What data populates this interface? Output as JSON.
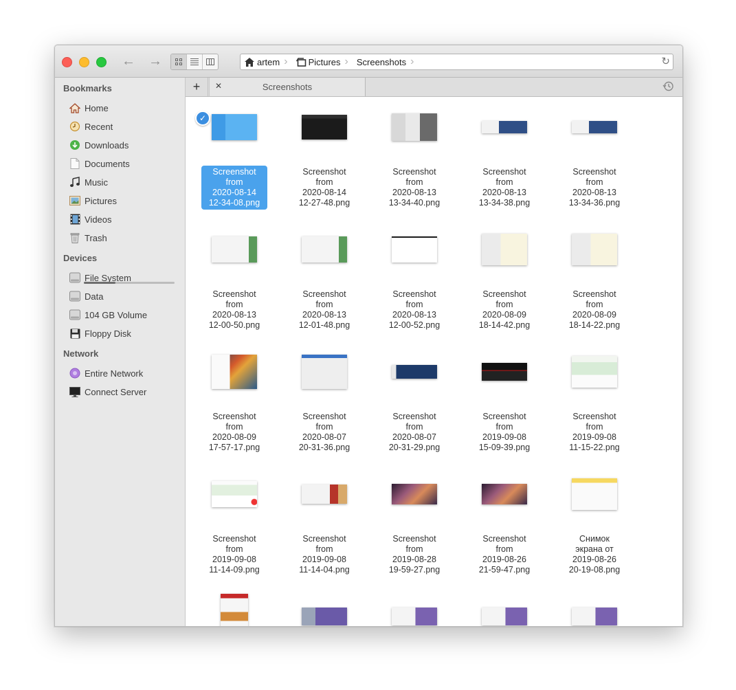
{
  "toolbar": {
    "back_icon": "←",
    "forward_icon": "→",
    "path": [
      {
        "label": "artem",
        "icon": "home-icon"
      },
      {
        "label": "Pictures",
        "icon": "pictures-icon"
      },
      {
        "label": "Screenshots",
        "icon": ""
      }
    ],
    "reload_icon": "↻"
  },
  "sidebar": {
    "bookmarks_heading": "Bookmarks",
    "bookmarks": [
      {
        "label": "Home",
        "icon": "home-icon"
      },
      {
        "label": "Recent",
        "icon": "clock-icon"
      },
      {
        "label": "Downloads",
        "icon": "download-icon"
      },
      {
        "label": "Documents",
        "icon": "document-icon"
      },
      {
        "label": "Music",
        "icon": "music-note-icon"
      },
      {
        "label": "Pictures",
        "icon": "pictures-icon"
      },
      {
        "label": "Videos",
        "icon": "film-icon"
      },
      {
        "label": "Trash",
        "icon": "trash-icon"
      }
    ],
    "devices_heading": "Devices",
    "devices": [
      {
        "label": "File System",
        "icon": "drive-icon"
      },
      {
        "label": "Data",
        "icon": "drive-icon"
      },
      {
        "label": "104 GB Volume",
        "icon": "drive-icon"
      },
      {
        "label": "Floppy Disk",
        "icon": "floppy-icon"
      }
    ],
    "file_system_usage": 0.35,
    "network_heading": "Network",
    "network": [
      {
        "label": "Entire Network",
        "icon": "network-icon"
      },
      {
        "label": "Connect Server",
        "icon": "monitor-icon"
      }
    ]
  },
  "tabs": {
    "new_tab": "+",
    "close": "✕",
    "active_label": "Screenshots"
  },
  "files": [
    {
      "name": "Screenshot\nfrom\n2020-08-14\n12-34-08.png",
      "selected": true,
      "style": "blue"
    },
    {
      "name": "Screenshot\nfrom\n2020-08-14\n12-27-48.png",
      "style": "dark"
    },
    {
      "name": "Screenshot\nfrom\n2020-08-13\n13-34-40.png",
      "style": "collage"
    },
    {
      "name": "Screenshot\nfrom\n2020-08-13\n13-34-38.png",
      "style": "desk"
    },
    {
      "name": "Screenshot\nfrom\n2020-08-13\n13-34-36.png",
      "style": "desk"
    },
    {
      "name": "Screenshot\nfrom\n2020-08-13\n12-00-50.png",
      "style": "white-green"
    },
    {
      "name": "Screenshot\nfrom\n2020-08-13\n12-01-48.png",
      "style": "white-green"
    },
    {
      "name": "Screenshot\nfrom\n2020-08-13\n12-00-52.png",
      "style": "white"
    },
    {
      "name": "Screenshot\nfrom\n2020-08-09\n18-14-42.png",
      "style": "ui-square"
    },
    {
      "name": "Screenshot\nfrom\n2020-08-09\n18-14-22.png",
      "style": "ui-square"
    },
    {
      "name": "Screenshot\nfrom\n2020-08-09\n17-57-17.png",
      "style": "abstract"
    },
    {
      "name": "Screenshot\nfrom\n2020-08-07\n20-31-36.png",
      "style": "filemanager"
    },
    {
      "name": "Screenshot\nfrom\n2020-08-07\n20-31-29.png",
      "style": "night"
    },
    {
      "name": "Screenshot\nfrom\n2019-09-08\n15-09-39.png",
      "style": "black-red"
    },
    {
      "name": "Screenshot\nfrom\n2019-09-08\n11-15-22.png",
      "style": "green-page"
    },
    {
      "name": "Screenshot\nfrom\n2019-09-08\n11-14-09.png",
      "style": "green-page-dot"
    },
    {
      "name": "Screenshot\nfrom\n2019-09-08\n11-14-04.png",
      "style": "web-red"
    },
    {
      "name": "Screenshot\nfrom\n2019-08-28\n19-59-27.png",
      "style": "sierra"
    },
    {
      "name": "Screenshot\nfrom\n2019-08-26\n21-59-47.png",
      "style": "sierra"
    },
    {
      "name": "Снимок\nэкрана от\n2019-08-26\n20-19-08.png",
      "style": "yellow-dialog"
    },
    {
      "name": "",
      "style": "phone"
    },
    {
      "name": "",
      "style": "purple"
    },
    {
      "name": "",
      "style": "purple-white"
    },
    {
      "name": "",
      "style": "purple-white"
    },
    {
      "name": "",
      "style": "purple-white"
    }
  ]
}
